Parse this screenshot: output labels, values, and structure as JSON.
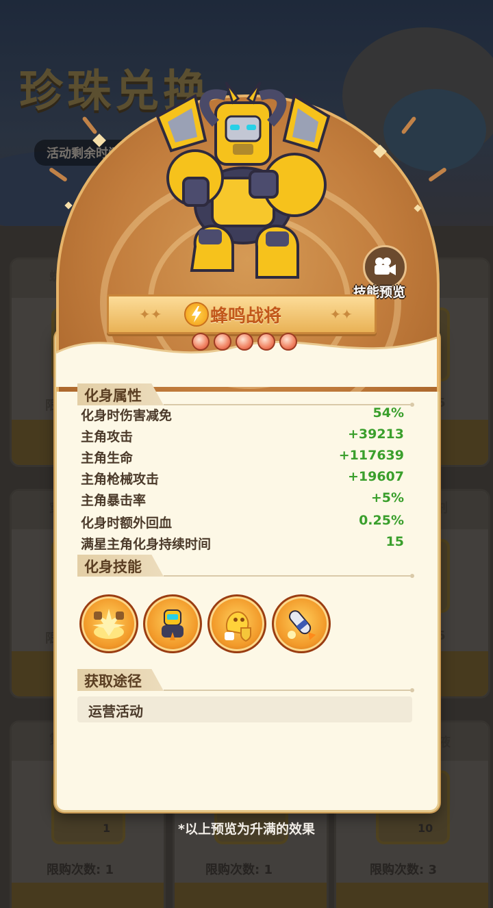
{
  "background": {
    "event_title": "珍珠兑换",
    "timer_label": "活动剩余时间:",
    "card_title_partials": [
      "蜘",
      "炮",
      "穿",
      "剂",
      "第",
      "液"
    ],
    "card_limit_partial": "限",
    "card_counts_right": [
      "5",
      "5"
    ],
    "item_counts": [
      "1",
      "10"
    ],
    "limits": [
      "限购次数: 1",
      "限购次数: 1",
      "限购次数: 3"
    ]
  },
  "hero": {
    "name": "蜂鸣战将",
    "star_count": 5,
    "preview_label": "技能预览",
    "icon": "lightning-bolt-icon"
  },
  "attributes": {
    "header": "化身属性",
    "rows": [
      {
        "label": "化身时伤害减免",
        "value": "54%"
      },
      {
        "label": "主角攻击",
        "value": "+39213"
      },
      {
        "label": "主角生命",
        "value": "+117639"
      },
      {
        "label": "主角枪械攻击",
        "value": "+19607"
      },
      {
        "label": "主角暴击率",
        "value": "+5%"
      },
      {
        "label": "化身时额外回血",
        "value": "0.25%"
      },
      {
        "label": "满星主角化身持续时间",
        "value": "15"
      }
    ]
  },
  "skills": {
    "header": "化身技能",
    "items": [
      {
        "icon": "fist-burst-skill-icon"
      },
      {
        "icon": "robot-bee-skill-icon"
      },
      {
        "icon": "yellow-blob-shield-skill-icon"
      },
      {
        "icon": "rocket-missile-skill-icon"
      }
    ]
  },
  "source": {
    "header": "获取途径",
    "value": "运营活动"
  },
  "footnote": "*以上预览为升满的效果",
  "colors": {
    "value_green": "#3a9f2c",
    "name_orange": "#c2581b",
    "panel_bg": "#fdf8e6",
    "arch_brown": "#c27d3d"
  }
}
